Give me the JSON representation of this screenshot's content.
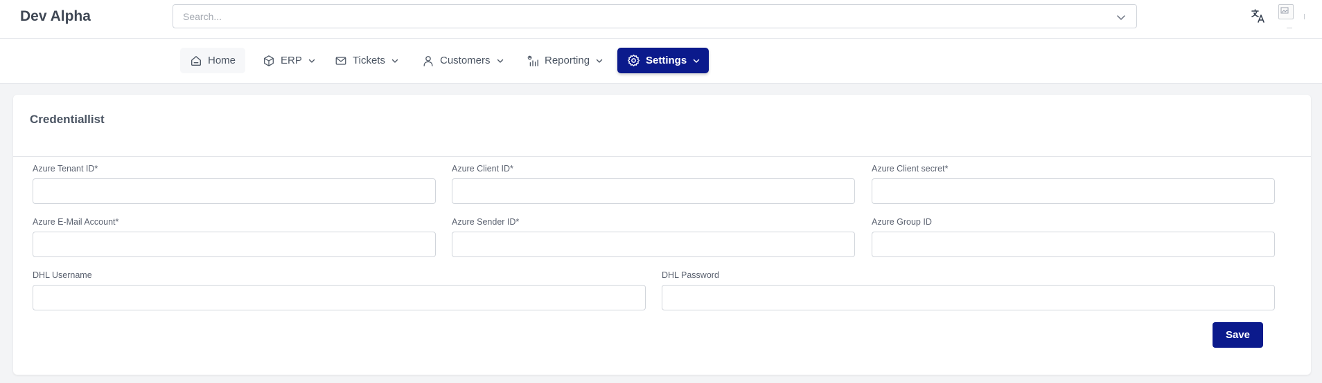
{
  "header": {
    "brand": "Dev Alpha",
    "search": {
      "placeholder": "Search...",
      "value": ""
    },
    "icons": [
      "translate-icon",
      "avatar-image"
    ]
  },
  "nav": {
    "items": [
      {
        "label": "Home",
        "icon": "home-icon",
        "active": false
      },
      {
        "label": "ERP",
        "icon": "cube-icon",
        "active": false
      },
      {
        "label": "Tickets",
        "icon": "mail-icon",
        "active": false
      },
      {
        "label": "Customers",
        "icon": "user-icon",
        "active": false
      },
      {
        "label": "Reporting",
        "icon": "chart-icon",
        "active": false
      },
      {
        "label": "Settings",
        "icon": "gear-icon",
        "active": true
      }
    ]
  },
  "form": {
    "title": "Credentiallist",
    "fields": [
      {
        "label": "Azure Tenant ID*",
        "value": ""
      },
      {
        "label": "Azure Client ID*",
        "value": ""
      },
      {
        "label": "Azure Client secret*",
        "value": ""
      },
      {
        "label": "Azure E-Mail Account*",
        "value": ""
      },
      {
        "label": "Azure Sender ID*",
        "value": ""
      },
      {
        "label": "Azure Group ID",
        "value": ""
      },
      {
        "label": "DHL Username",
        "value": ""
      },
      {
        "label": "DHL Password",
        "value": ""
      }
    ],
    "save_label": "Save"
  },
  "colors": {
    "accent": "#0b1a8c",
    "background": "#f3f4f6"
  }
}
